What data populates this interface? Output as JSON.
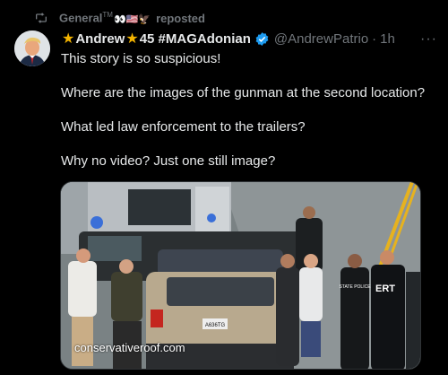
{
  "repost": {
    "user": "General",
    "tm": "TM",
    "emojis": "👀🇺🇸🦅",
    "label": "reposted",
    "icon": "repost-icon"
  },
  "author": {
    "name_prefix": "★",
    "name_main": "Andrew",
    "name_mid": "★",
    "name_rest": "45 #MAGAdonian",
    "verified": true,
    "handle": "@AndrewPatrio",
    "separator": "·",
    "time": "1h",
    "more": "···"
  },
  "tweet": {
    "lines": [
      "This story is so suspicious!",
      "Where are the images of the gunman at the second location?",
      "What led law enforcement to the trailers?",
      "Why no video? Just one still image?"
    ]
  },
  "media": {
    "watermark": "conservativeroof.com",
    "plate": "A636TG",
    "vest_left": "STATE POLICE",
    "vest_right": "ERT"
  },
  "colors": {
    "background": "#000000",
    "text": "#e7e9ea",
    "muted": "#71767b",
    "verified": "#1d9bf0",
    "star": "#f4b400"
  }
}
